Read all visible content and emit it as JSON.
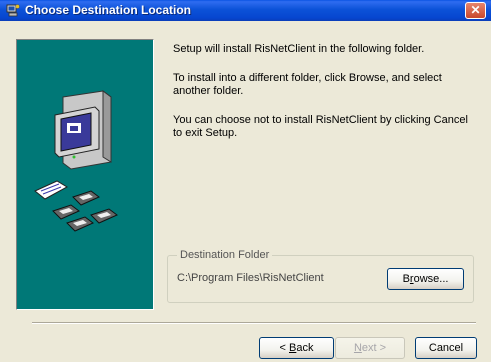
{
  "window": {
    "title": "Choose Destination Location",
    "close_glyph": "✕"
  },
  "icons": {
    "title_icon": "setup-installer-icon",
    "panel_art": "computer-with-disks-illustration"
  },
  "colors": {
    "titlebar": "#0a54e3",
    "panel": "#007877",
    "dialog_bg": "#ece9d8"
  },
  "body": {
    "paragraph1": "Setup will install RisNetClient in the following folder.",
    "paragraph2": "To install into a different folder, click Browse, and select another folder.",
    "paragraph3": "You can choose not to install RisNetClient by clicking Cancel to exit Setup."
  },
  "destination": {
    "legend": "Destination Folder",
    "path": "C:\\Program Files\\RisNetClient",
    "browse_prefix": "B",
    "browse_access": "r",
    "browse_suffix": "owse..."
  },
  "buttons": {
    "back_prefix": "< ",
    "back_access": "B",
    "back_suffix": "ack",
    "next_access": "N",
    "next_suffix": "ext >",
    "cancel": "Cancel"
  }
}
